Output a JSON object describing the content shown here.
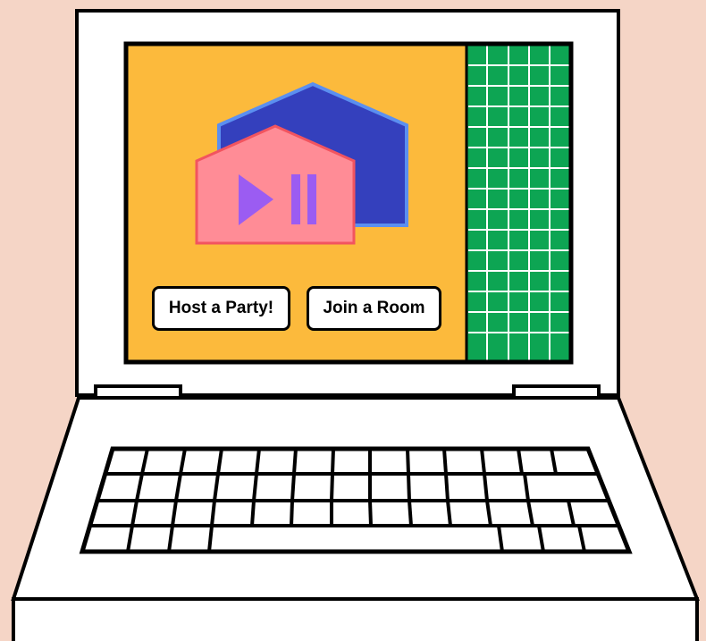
{
  "app": {
    "host_label": "Host a Party!",
    "join_label": "Join a Room"
  },
  "colors": {
    "page_background": "#f5d5c6",
    "screen_background": "#fcba3c",
    "grid_panel": "#0da553",
    "back_house": "#3440bd",
    "back_house_outline": "#5b8ff0",
    "front_house": "#ff8c96",
    "front_house_outline": "#f2545f",
    "play_pause": "#9b5cf2"
  },
  "icons": {
    "logo": "house-play-pause-logo",
    "play": "play-icon",
    "pause": "pause-icon"
  }
}
